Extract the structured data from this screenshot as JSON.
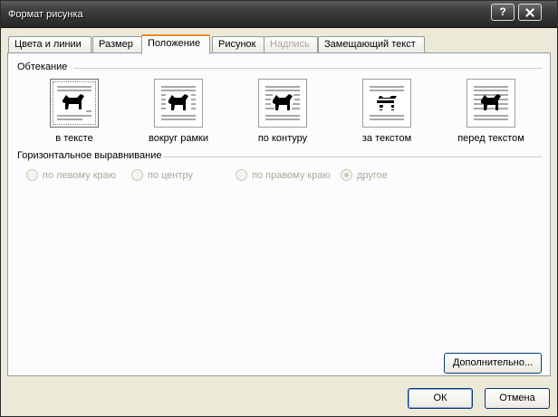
{
  "window": {
    "title": "Формат рисунка",
    "help_label": "?"
  },
  "tabs": [
    {
      "label": "Цвета и линии",
      "state": "normal"
    },
    {
      "label": "Размер",
      "state": "normal"
    },
    {
      "label": "Положение",
      "state": "active"
    },
    {
      "label": "Рисунок",
      "state": "normal"
    },
    {
      "label": "Надпись",
      "state": "disabled"
    },
    {
      "label": "Замещающий текст",
      "state": "normal"
    }
  ],
  "wrapping": {
    "title": "Обтекание",
    "options": [
      {
        "label": "в тексте",
        "icon": "inline-with-text-icon",
        "selected": true
      },
      {
        "label": "вокруг рамки",
        "icon": "square-wrap-icon",
        "selected": false
      },
      {
        "label": "по контуру",
        "icon": "tight-wrap-icon",
        "selected": false
      },
      {
        "label": "за текстом",
        "icon": "behind-text-icon",
        "selected": false
      },
      {
        "label": "перед текстом",
        "icon": "in-front-of-text-icon",
        "selected": false
      }
    ]
  },
  "alignment": {
    "title": "Горизонтальное выравнивание",
    "options": [
      {
        "label": "по левому краю",
        "checked": false
      },
      {
        "label": "по центру",
        "checked": false
      },
      {
        "label": "по правому краю",
        "checked": false
      },
      {
        "label": "другое",
        "checked": true
      }
    ]
  },
  "buttons": {
    "advanced": "Дополнительно...",
    "ok": "ОК",
    "cancel": "Отмена"
  },
  "colors": {
    "title_bar": "#262626",
    "dialog_bg": "#ece9d8",
    "panel_bg": "#fcfcfe",
    "active_tab_accent": "#e68b2c",
    "disabled_text": "#aca899"
  }
}
